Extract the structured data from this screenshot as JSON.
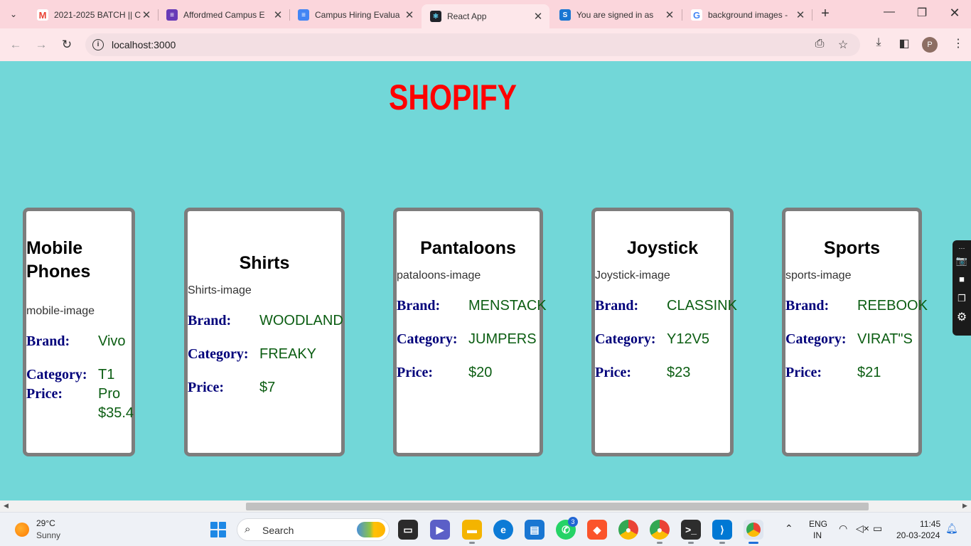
{
  "browser": {
    "tabs": [
      {
        "title": "2021-2025 BATCH || C",
        "favicon": "gmail-icon",
        "color": "#ea4335"
      },
      {
        "title": "Affordmed Campus E",
        "favicon": "forms-icon",
        "color": "#673ab7"
      },
      {
        "title": "Campus Hiring Evalua",
        "favicon": "docs-icon",
        "color": "#4285f4"
      },
      {
        "title": "React App",
        "favicon": "react-icon",
        "color": "#20232a"
      },
      {
        "title": "You are signed in as",
        "favicon": "s-icon",
        "color": "#1976d2"
      },
      {
        "title": "background images -",
        "favicon": "google-icon",
        "color": "#4285f4"
      }
    ],
    "active_tab": 3,
    "url": "localhost:3000",
    "profile_initial": "P"
  },
  "page": {
    "title": "SHOPIFY",
    "background": "#72d7d8",
    "labels": {
      "brand": "Brand:",
      "category": "Category:",
      "price": "Price:"
    },
    "cards": [
      {
        "name": "Mobile Phones",
        "image_alt": "mobile-image",
        "brand": "Vivo",
        "category": "T1 Pro",
        "price": "$35.4"
      },
      {
        "name": "Shirts",
        "image_alt": "Shirts-image",
        "brand": "WOODLAND",
        "category": "FREAKY",
        "price": "$7"
      },
      {
        "name": "Pantaloons",
        "image_alt": "pataloons-image",
        "brand": "MENSTACK",
        "category": "JUMPERS",
        "price": "$20"
      },
      {
        "name": "Joystick",
        "image_alt": "Joystick-image",
        "brand": "CLASSINK",
        "category": "Y12V5",
        "price": "$23"
      },
      {
        "name": "Sports",
        "image_alt": "sports-image",
        "brand": "REEBOOK",
        "category": "VIRAT\"S",
        "price": "$21"
      }
    ]
  },
  "taskbar": {
    "weather": {
      "temp": "29°C",
      "condition": "Sunny"
    },
    "search_label": "Search",
    "whatsapp_badge": "3",
    "lang": {
      "line1": "ENG",
      "line2": "IN"
    },
    "clock": {
      "time": "11:45",
      "date": "20-03-2024"
    }
  }
}
